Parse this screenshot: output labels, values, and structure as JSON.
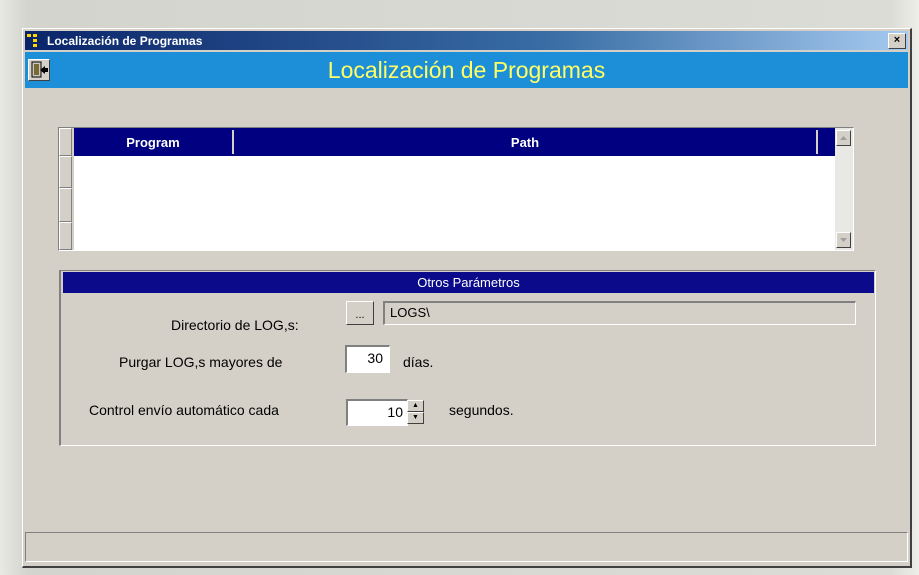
{
  "window": {
    "title": "Localización de Programas",
    "close_icon": "×"
  },
  "header": {
    "title": "Localización de Programas",
    "exit_icon": "exit-door-icon"
  },
  "grid": {
    "columns": [
      "Program",
      "Path"
    ],
    "rows": []
  },
  "params": {
    "title": "Otros Parámetros",
    "log_dir_label": "Directorio de LOG,s:",
    "browse_label": "...",
    "log_dir_value": "LOGS\\",
    "purge_label": "Purgar LOG,s mayores de",
    "purge_value": "30",
    "purge_unit": "días.",
    "control_label": "Control envío automático cada",
    "control_value": "10",
    "control_unit": "segundos."
  },
  "status": {
    "text": ""
  },
  "colors": {
    "header_band": "#1d8fd8",
    "header_text": "#ffff66",
    "grid_header": "#000080",
    "group_title": "#0a0a8a"
  }
}
